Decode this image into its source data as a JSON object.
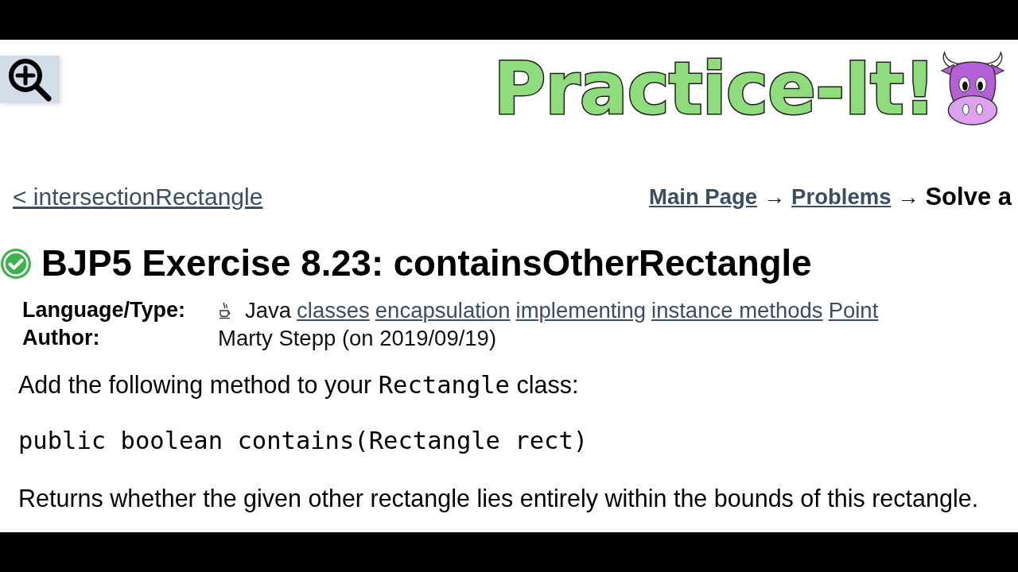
{
  "logo": {
    "text": "Practice-It!"
  },
  "back_link": "< intersectionRectangle",
  "breadcrumbs": [
    {
      "kind": "link",
      "label": "Main Page"
    },
    {
      "kind": "separator",
      "label": "→"
    },
    {
      "kind": "link",
      "label": "Problems"
    },
    {
      "kind": "separator",
      "label": "→"
    },
    {
      "kind": "current",
      "label": "Solve a"
    }
  ],
  "problem": {
    "solved": true,
    "title": "BJP5 Exercise 8.23: containsOtherRectangle",
    "details": [
      {
        "kind": "tags",
        "label": "Language/Type:",
        "language": "Java",
        "tags": [
          "classes",
          "encapsulation",
          "implementing",
          "instance methods",
          "Point"
        ]
      },
      {
        "kind": "text",
        "label": "Author:",
        "value": "Marty Stepp (on 2019/09/19)"
      }
    ],
    "description": [
      {
        "kind": "paragraph",
        "parts": [
          {
            "kind": "text",
            "text": "Add the following method to your "
          },
          {
            "kind": "code",
            "text": "Rectangle"
          },
          {
            "kind": "text",
            "text": " class:"
          }
        ]
      },
      {
        "kind": "code",
        "text": "public boolean contains(Rectangle rect)"
      },
      {
        "kind": "paragraph",
        "parts": [
          {
            "kind": "text",
            "text": "Returns whether the given other rectangle lies entirely within the bounds of this rectangle."
          }
        ]
      }
    ]
  }
}
